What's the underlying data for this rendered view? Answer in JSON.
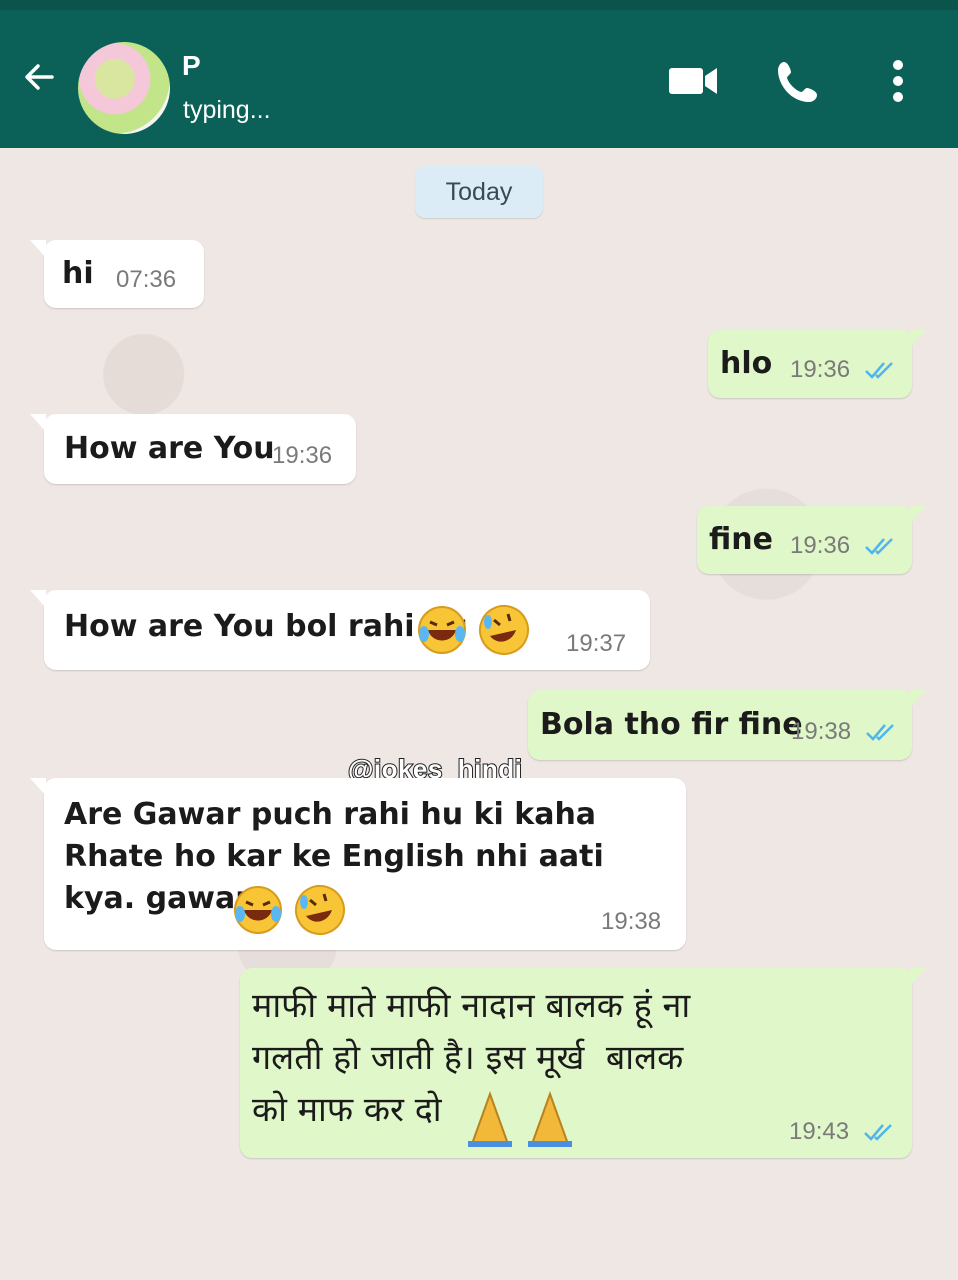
{
  "header": {
    "contact_name": "P",
    "status": "typing...",
    "back_icon": "arrow-left-icon",
    "video_icon": "video-camera-icon",
    "call_icon": "phone-icon",
    "menu_icon": "vertical-dots-icon",
    "color": "#0b6157"
  },
  "date_separator": "Today",
  "watermark": "@jokes_hindi",
  "messages": [
    {
      "dir": "in",
      "text": "hi",
      "time": "07:36"
    },
    {
      "dir": "out",
      "text": "hlo",
      "time": "19:36"
    },
    {
      "dir": "in",
      "text": "How are You",
      "time": "19:36"
    },
    {
      "dir": "out",
      "text": "fine",
      "time": "19:36"
    },
    {
      "dir": "in",
      "text": "How are You bol rahi hu",
      "time": "19:37"
    },
    {
      "dir": "out",
      "text": "Bola tho fir fine",
      "time": "19:38"
    },
    {
      "dir": "in",
      "text": "Are Gawar puch rahi hu ki kaha\nRhate ho kar ke English nhi aati\nkya. gawar",
      "time": "19:38"
    },
    {
      "dir": "out",
      "text": "माफी माते माफी नादान बालक हूं ना\nगलती हो जाती है। इस मूर्ख  बालक\nको माफ कर दो",
      "time": "19:43"
    }
  ],
  "colors": {
    "incoming": "#ffffff",
    "outgoing": "#e0f7c9",
    "tick_read": "#4fb6ec"
  }
}
